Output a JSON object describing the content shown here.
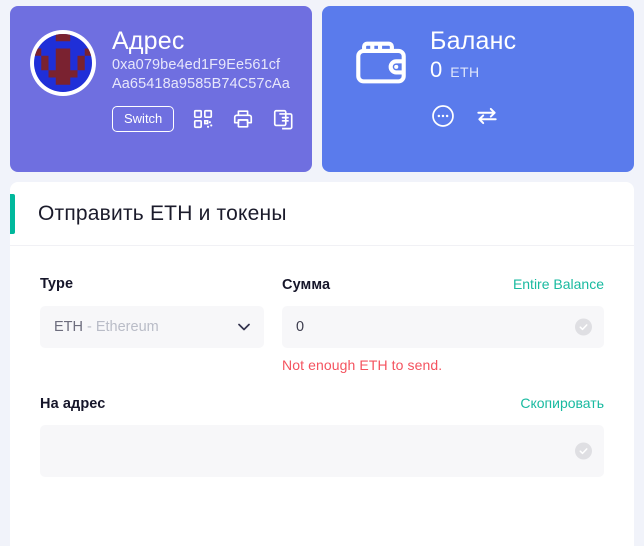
{
  "theme": {
    "page_bg": "#f1f3fa",
    "address_card_bg": "#6f6fe0",
    "balance_card_bg": "#5a7bec",
    "accent_teal": "#00b89c",
    "link_teal": "#19baa0",
    "error_red": "#f4535f",
    "panel_bg": "#ffffff",
    "field_bg": "#f7f7f9"
  },
  "address_card": {
    "title": "Адрес",
    "avatar_icon": "identicon-avatar",
    "address_line_1": "0xa079be4ed1F9Ee561cf",
    "address_line_2": "Aa65418a9585B74C57cAa",
    "switch_label": "Switch",
    "actions": [
      {
        "icon": "qr-code-icon",
        "name": "show-qr-button"
      },
      {
        "icon": "printer-icon",
        "name": "print-button"
      },
      {
        "icon": "copy-icon",
        "name": "copy-address-button"
      }
    ]
  },
  "balance_card": {
    "title": "Баланс",
    "wallet_icon": "wallet-icon",
    "amount": "0",
    "unit": "ETH",
    "actions": [
      {
        "icon": "more-options-icon",
        "name": "more-options-button"
      },
      {
        "icon": "swap-arrows-icon",
        "name": "swap-button"
      }
    ]
  },
  "send_panel": {
    "heading": "Отправить ETH и токены",
    "type_field": {
      "label": "Type",
      "selected_symbol": "ETH",
      "selected_name": "- Ethereum",
      "chevron_icon": "chevron-down-icon"
    },
    "amount_field": {
      "label": "Сумма",
      "link_label": "Entire Balance",
      "value": "0",
      "placeholder": "0",
      "status_icon": "check-circle-icon",
      "error": "Not enough ETH to send."
    },
    "to_address_field": {
      "label": "На адрес",
      "link_label": "Скопировать",
      "value": "",
      "placeholder": "",
      "status_icon": "check-circle-icon"
    }
  }
}
